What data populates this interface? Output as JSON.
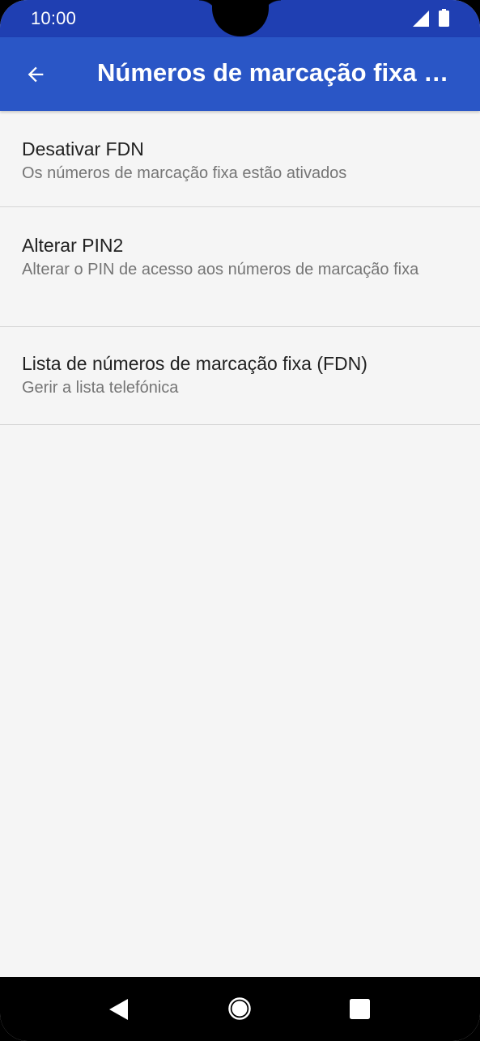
{
  "status_bar": {
    "time": "10:00",
    "icons": [
      "signal-icon",
      "battery-icon"
    ]
  },
  "app_bar": {
    "back_icon": "arrow-back-icon",
    "title": "Números de marcação fixa (FDN)"
  },
  "list": {
    "items": [
      {
        "title": "Desativar FDN",
        "summary": "Os números de marcação fixa estão ativados"
      },
      {
        "title": "Alterar PIN2",
        "summary": "Alterar o PIN de acesso aos números de marcação fixa"
      },
      {
        "title": "Lista de números de marcação fixa (FDN)",
        "summary": "Gerir a lista telefónica"
      }
    ]
  },
  "nav_bar": {
    "icons": [
      "nav-back-icon",
      "nav-home-icon",
      "nav-recents-icon"
    ]
  },
  "colors": {
    "status_bar": "#1f3fb2",
    "app_bar": "#2a56c6",
    "background": "#f5f5f5",
    "title_text": "#212121",
    "summary_text": "#757575",
    "divider": "#d6d6d6"
  }
}
